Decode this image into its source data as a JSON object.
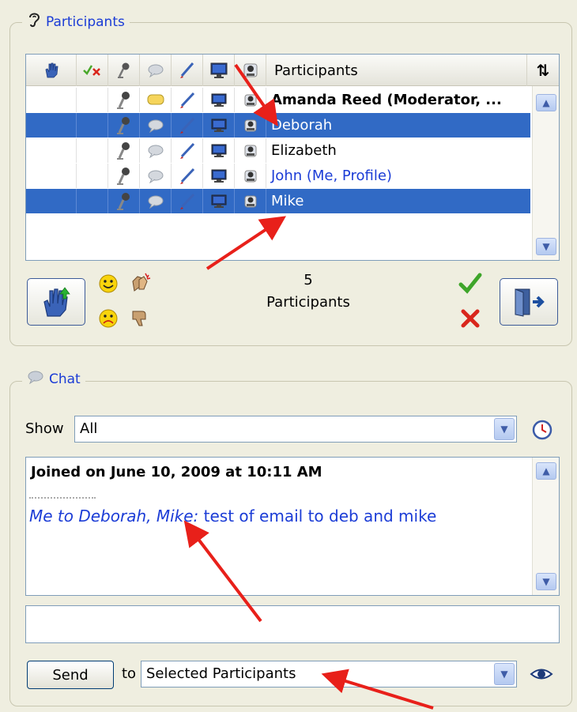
{
  "participants_group": {
    "title": "Participants",
    "title_icon": "ear-icon",
    "column_header_label": "Participants",
    "sort_icon": "sort-arrows-icon",
    "rows": [
      {
        "name": "Amanda Reed (Moderator, ...",
        "selected": false,
        "style": "bold"
      },
      {
        "name": "Deborah",
        "selected": true,
        "style": "normal"
      },
      {
        "name": "Elizabeth",
        "selected": false,
        "style": "normal"
      },
      {
        "name": "John (Me, Profile)",
        "selected": false,
        "style": "blue"
      },
      {
        "name": "Mike",
        "selected": true,
        "style": "normal"
      }
    ],
    "count": "5",
    "count_label": "Participants"
  },
  "chat_group": {
    "title": "Chat",
    "title_icon": "speech-bubble-icon",
    "show_label": "Show",
    "show_value": "All",
    "history_icon": "clock-icon",
    "log_header": "Joined on June 10, 2009 at 10:11 AM",
    "message_sender": "Me to Deborah, Mike:",
    "message_text": " test of email to deb and mike",
    "input_value": "",
    "send_label": "Send",
    "to_label": "to",
    "recipient_value": "Selected Participants",
    "preview_icon": "eye-icon"
  },
  "colors": {
    "panel_bg": "#efeee0",
    "selection": "#316ac5",
    "link_blue": "#1b3cd6",
    "annotation_red": "#e8201a"
  }
}
